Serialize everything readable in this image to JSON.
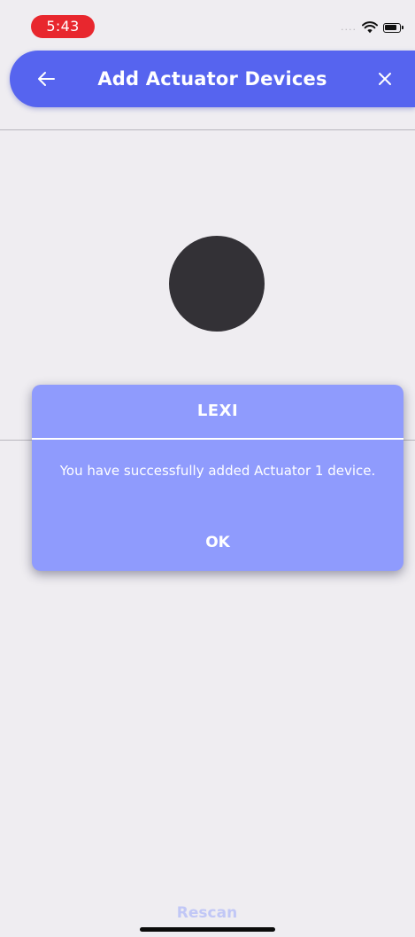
{
  "status_bar": {
    "time": "5:43",
    "signal_dots": "....",
    "wifi_icon": "wifi-icon",
    "battery_icon": "battery-icon"
  },
  "app_bar": {
    "title": "Add Actuator Devices",
    "back_icon": "back-arrow-icon",
    "close_icon": "close-icon",
    "background_color": "#5664ef"
  },
  "dialog": {
    "title": "LEXI",
    "message": "You have successfully added Actuator 1 device.",
    "ok_label": "OK",
    "background_color": "#8f9bfd"
  },
  "footer": {
    "rescan_label": "Rescan"
  }
}
